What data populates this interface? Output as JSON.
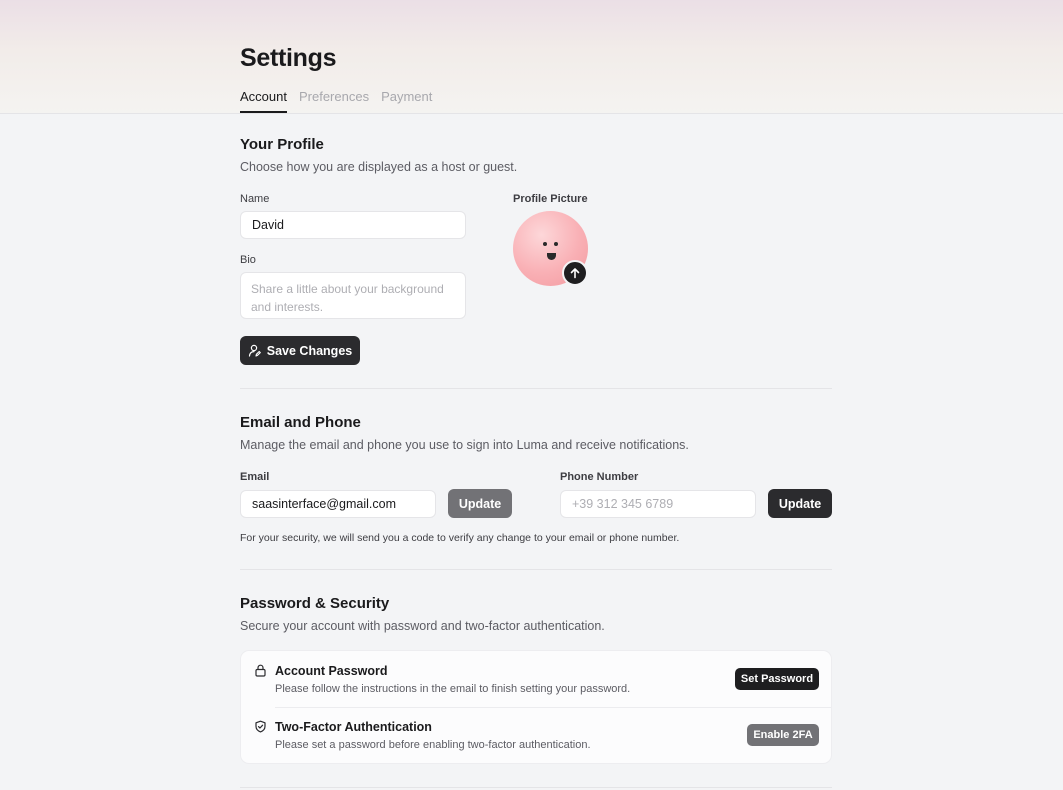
{
  "page": {
    "title": "Settings",
    "tabs": [
      {
        "label": "Account",
        "active": true
      },
      {
        "label": "Preferences",
        "active": false
      },
      {
        "label": "Payment",
        "active": false
      }
    ]
  },
  "profile": {
    "title": "Your Profile",
    "subtitle": "Choose how you are displayed as a host or guest.",
    "name_label": "Name",
    "name_value": "David",
    "bio_label": "Bio",
    "bio_placeholder": "Share a little about your background and interests.",
    "picture_label": "Profile Picture",
    "save_label": "Save Changes",
    "save_icon": "user-edit-icon",
    "upload_icon": "arrow-up-icon"
  },
  "email_phone": {
    "title": "Email and Phone",
    "subtitle": "Manage the email and phone you use to sign into Luma and receive notifications.",
    "email_label": "Email",
    "email_value": "saasinterface@gmail.com",
    "email_update_label": "Update",
    "phone_label": "Phone Number",
    "phone_placeholder": "+39 312 345 6789",
    "phone_update_label": "Update",
    "note": "For your security, we will send you a code to verify any change to your email or phone number."
  },
  "security": {
    "title": "Password & Security",
    "subtitle": "Secure your account with password and two-factor authentication.",
    "items": [
      {
        "icon": "lock-icon",
        "title": "Account Password",
        "description": "Please follow the instructions in the email to finish setting your password.",
        "action_label": "Set Password"
      },
      {
        "icon": "shield-check-icon",
        "title": "Two-Factor Authentication",
        "description": "Please set a password before enabling two-factor authentication.",
        "action_label": "Enable 2FA"
      }
    ]
  },
  "colors": {
    "background": "#f3f4f6",
    "primary_button": "#2b2b2e",
    "disabled_button": "#727276",
    "avatar": "#f9b0b5"
  }
}
